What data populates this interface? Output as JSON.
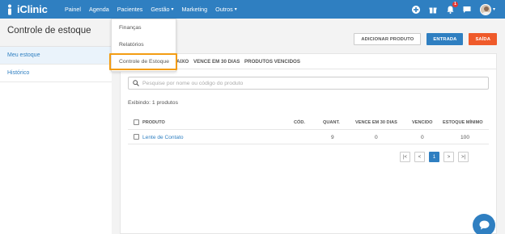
{
  "app": {
    "logo_text": "iClinic"
  },
  "nav": {
    "items": [
      {
        "label": "Painel"
      },
      {
        "label": "Agenda"
      },
      {
        "label": "Pacientes"
      },
      {
        "label": "Gestão"
      },
      {
        "label": "Marketing"
      },
      {
        "label": "Outros"
      }
    ],
    "notification_count": "1"
  },
  "page": {
    "title": "Controle de estoque"
  },
  "sidebar": {
    "items": [
      {
        "label": "Meu estoque",
        "active": true
      },
      {
        "label": "Histórico",
        "active": false
      }
    ]
  },
  "actions": {
    "add_product": "ADICIONAR PRODUTO",
    "entrada": "ENTRADA",
    "saida": "SAÍDA"
  },
  "tabs": {
    "partial": "AIXO",
    "expiring": "VENCE EM 30 DIAS",
    "expired": "PRODUTOS VENCIDOS"
  },
  "search": {
    "placeholder": "Pesquise por nome ou código do produto"
  },
  "results": {
    "count_text": "Exibindo: 1 produtos"
  },
  "table": {
    "headers": {
      "produto": "PRODUTO",
      "cod": "CÓD.",
      "quant": "QUANT.",
      "vence": "VENCE EM 30 DIAS",
      "vencido": "VENCIDO",
      "estoque_min": "ESTOQUE MÍNIMO"
    },
    "rows": [
      {
        "produto": "Lente de Contato",
        "cod": "",
        "quant": "9",
        "vence": "0",
        "vencido": "0",
        "estoque_min": "100"
      }
    ]
  },
  "pagination": {
    "first": "|<",
    "prev": "<",
    "current": "1",
    "next": ">",
    "last": ">|"
  },
  "dropdown": {
    "items": [
      {
        "label": "Finanças"
      },
      {
        "label": "Relatórios"
      },
      {
        "label": "Controle de Estoque"
      }
    ]
  },
  "colors": {
    "primary": "#2f7fc1",
    "danger": "#ef5a2a",
    "highlight": "#f39c12"
  }
}
